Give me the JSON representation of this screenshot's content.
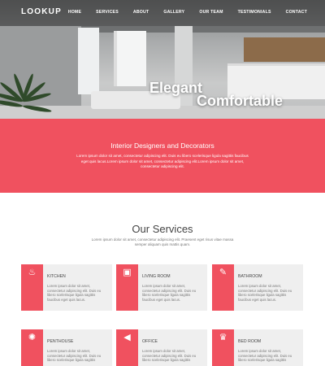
{
  "nav": {
    "logo": "LOOKUP",
    "items": [
      "HOME",
      "SERVICES",
      "ABOUT",
      "GALLERY",
      "OUR TEAM",
      "TESTIMONIALS",
      "CONTACT"
    ]
  },
  "hero": {
    "line1": "Elegant",
    "line2": "Comfortable"
  },
  "band": {
    "title": "Interior Designers and Decorators",
    "text": "Lorem ipsum dolor sit amet, consectetur adipiscing elit. Duis eu libero scelerisque ligula sagittis faucibus eget quis lacus.Lorem ipsum dolor sit amet, consectetur adipiscing elit.Lorem ipsum dolor sit amet, consectetur adipiscing elit."
  },
  "services": {
    "title": "Our Services",
    "subtitle": "Lorem ipsum dolor sit amet, consectetur adipiscing elit. Praesent eget risus vitae massa semper aliquam quis mattis quam.",
    "cards": [
      {
        "title": "KITCHEN",
        "icon": "chef-hat-icon",
        "glyph": "♨",
        "text": "Lorem ipsum dolor sit amet, consectetur adipiscing elit. Duis eu libero scelerisque ligula sagittis faucibus eget quis lacus."
      },
      {
        "title": "LIVING ROOM",
        "icon": "briefcase-icon",
        "glyph": "▣",
        "text": "Lorem ipsum dolor sit amet, consectetur adipiscing elit. Duis eu libero scelerisque ligula sagittis faucibus eget quis lacus."
      },
      {
        "title": "BATHROOM",
        "icon": "pencil-ruler-icon",
        "glyph": "✎",
        "text": "Lorem ipsum dolor sit amet, consectetur adipiscing elit. Duis eu libero scelerisque ligula sagittis faucibus eget quis lacus."
      },
      {
        "title": "PENTHOUSE",
        "icon": "atom-icon",
        "glyph": "✺",
        "text": "Lorem ipsum dolor sit amet, consectetur adipiscing elit. Duis eu libero scelerisque ligula sagittis"
      },
      {
        "title": "OFFICE",
        "icon": "megaphone-icon",
        "glyph": "◀",
        "text": "Lorem ipsum dolor sit amet, consectetur adipiscing elit. Duis eu libero scelerisque ligula sagittis"
      },
      {
        "title": "BED ROOM",
        "icon": "trophy-icon",
        "glyph": "♛",
        "text": "Lorem ipsum dolor sit amet, consectetur adipiscing elit. Duis eu libero scelerisque ligula sagittis"
      }
    ]
  },
  "colors": {
    "accent": "#f0515f",
    "card_bg": "#efefef"
  }
}
